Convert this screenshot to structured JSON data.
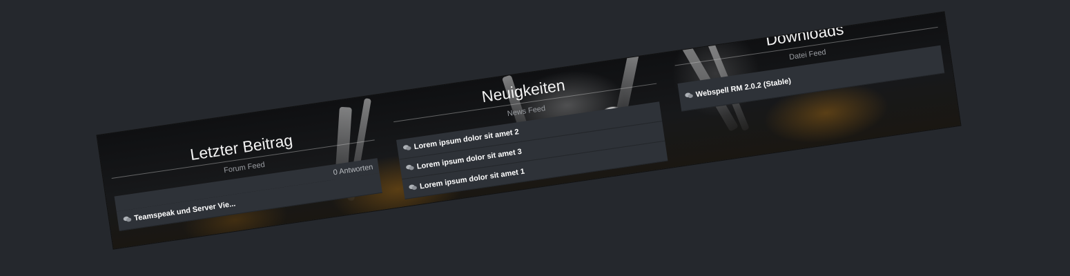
{
  "columns": [
    {
      "title": "Letzter Beitrag",
      "subtitle": "Forum Feed",
      "meta": "0 Antworten",
      "items": [
        {
          "icon": "chat-bubbles-icon",
          "label": "Teamspeak und Server Vie..."
        }
      ]
    },
    {
      "title": "Neuigkeiten",
      "subtitle": "News Feed",
      "items": [
        {
          "icon": "chat-bubbles-icon",
          "label": "Lorem ipsum dolor sit amet 2"
        },
        {
          "icon": "chat-bubbles-icon",
          "label": "Lorem ipsum dolor sit amet 3"
        },
        {
          "icon": "chat-bubbles-icon",
          "label": "Lorem ipsum dolor sit amet 1"
        }
      ]
    },
    {
      "title": "Downloads",
      "subtitle": "Datei Feed",
      "items": [
        {
          "icon": "chat-bubbles-icon",
          "label": "Webspell RM 2.0.2 (Stable)"
        }
      ]
    }
  ],
  "colors": {
    "page_background": "#25282d",
    "item_background": "#2e3238",
    "accent_orange": "#b07414"
  }
}
